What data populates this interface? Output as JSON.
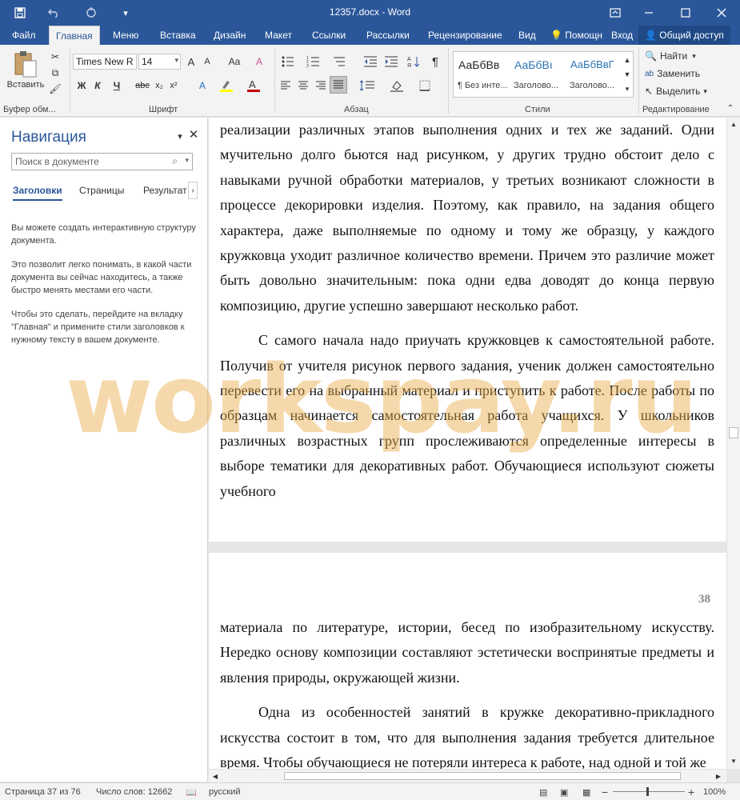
{
  "app": {
    "title": "12357.docx - Word"
  },
  "titlebar_icons": {
    "save": "save-icon",
    "undo": "undo-icon",
    "redo": "redo-icon",
    "customize": "customize-icon",
    "ribbon_display": "ribbon-display-icon",
    "minimize": "minimize-icon",
    "maximize": "maximize-icon",
    "close": "close-icon"
  },
  "menu": {
    "tabs": [
      "Файл",
      "Главная",
      "Меню",
      "Вставка",
      "Дизайн",
      "Макет",
      "Ссылки",
      "Рассылки",
      "Рецензирование",
      "Вид"
    ],
    "active": "Главная",
    "help": "Помощн",
    "signin": "Вход",
    "share": "Общий доступ"
  },
  "ribbon": {
    "clipboard": {
      "paste_label": "Вставить",
      "group_label": "Буфер обм..."
    },
    "font": {
      "font_name": "Times New R",
      "font_size": "14",
      "bold": "Ж",
      "italic": "К",
      "underline": "Ч",
      "strike": "abc",
      "subscript": "x₂",
      "superscript": "x²",
      "grow": "A",
      "shrink": "A",
      "case": "Aa",
      "group_label": "Шрифт"
    },
    "paragraph": {
      "group_label": "Абзац",
      "pilcrow": "¶"
    },
    "styles": {
      "group_label": "Стили",
      "items": [
        {
          "sample": "АаБбВв",
          "name": "¶ Без инте..."
        },
        {
          "sample": "АаБбВı",
          "name": "Заголово..."
        },
        {
          "sample": "АаБбВвГ",
          "name": "Заголово..."
        }
      ]
    },
    "editing": {
      "group_label": "Редактирование",
      "find": "Найти",
      "replace": "Заменить",
      "select": "Выделить"
    }
  },
  "nav": {
    "title": "Навигация",
    "search_placeholder": "Поиск в документе",
    "tabs": [
      "Заголовки",
      "Страницы",
      "Результат"
    ],
    "text1": "Вы можете создать интерактивную структуру документа.",
    "text2": "Это позволит легко понимать, в какой части документа вы сейчас находитесь, а также быстро менять местами его части.",
    "text3": "Чтобы это сделать, перейдите на вкладку \"Главная\" и примените стили заголовков к нужному тексту в вашем документе."
  },
  "document": {
    "page1_para1": "реализации различных этапов выполнения одних и тех же заданий. Одни мучительно долго бьются над рисунком, у других трудно обстоит дело с навыками ручной обработки материалов, у третьих возникают сложности в процессе декорировки изделия. Поэтому, как правило, на задания общего характера, даже выполняемые по одному и тому же образцу, у каждого кружковца уходит различное количество времени. Причем это различие может быть довольно значительным: пока одни едва доводят до конца первую композицию, другие успешно завершают несколько работ.",
    "page1_para2": "С самого начала надо приучать кружковцев к самостоятельной работе. Получив от учителя рисунок первого задания, ученик должен самостоятельно перевести его на выбранный материал и приступить к работе. После работы по образцам начинается самостоятельная работа учащихся. У школьников различных возрастных групп прослеживаются определенные интересы в выборе тематики для декоративных работ. Обучающиеся используют сюжеты учебного",
    "page_number": "38",
    "page2_para1": "материала по литературе, истории, бесед по изобразительному искусству. Нередко основу композиции составляют эстетически воспринятые предметы и явления природы, окружающей жизни.",
    "page2_para2": "Одна из особенностей занятий в кружке декоративно-прикладного искусства состоит в том, что для выполнения задания требуется длительное время. Чтобы обучающиеся не потеряли интереса к работе, над одной и той же"
  },
  "watermark": "workspay.ru",
  "status": {
    "page": "Страница 37 из 76",
    "words": "Число слов: 12662",
    "language": "русский",
    "zoom": "100%",
    "zoom_minus": "−",
    "zoom_plus": "+"
  },
  "colors": {
    "accent": "#2b579a",
    "watermark": "#e8aa46"
  }
}
